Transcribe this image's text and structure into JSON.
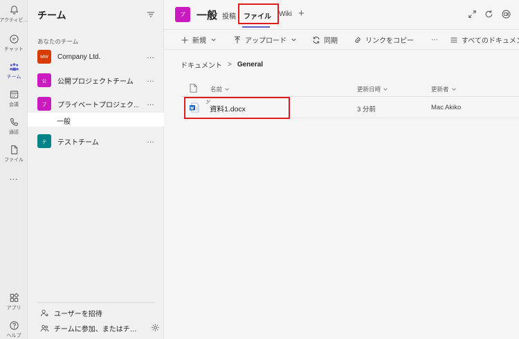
{
  "rail": {
    "items": [
      {
        "label": "アクティビ…",
        "icon": "bell-icon"
      },
      {
        "label": "チャット",
        "icon": "chat-icon"
      },
      {
        "label": "チーム",
        "icon": "teams-icon",
        "active": true
      },
      {
        "label": "会議",
        "icon": "calendar-icon"
      },
      {
        "label": "通話",
        "icon": "phone-icon"
      },
      {
        "label": "ファイル",
        "icon": "file-icon"
      }
    ],
    "more": "…",
    "apps_label": "アプリ",
    "help_label": "ヘルプ"
  },
  "sidebar": {
    "title": "チーム",
    "section_label": "あなたのチーム",
    "teams": [
      {
        "name": "Company Ltd.",
        "avatar": "MW",
        "color": "#d83b01"
      },
      {
        "name": "公開プロジェクトチーム",
        "avatar": "公",
        "color": "#c91bbf"
      },
      {
        "name": "プライベートプロジェク…",
        "avatar": "プ",
        "color": "#c91bbf"
      },
      {
        "name": "テストチーム",
        "avatar": "テ",
        "color": "#038387"
      }
    ],
    "more": "…",
    "channel": "一般",
    "invite_label": "ユーザーを招待",
    "join_label": "チームに参加、またはチ…"
  },
  "header": {
    "avatar": "プ",
    "title": "一般",
    "tabs": [
      "投稿",
      "ファイル",
      "Wiki"
    ],
    "active_tab": "ファイル",
    "add": "+"
  },
  "toolbar": {
    "new_label": "新規",
    "upload_label": "アップロード",
    "sync_label": "同期",
    "copy_link_label": "リンクをコピー",
    "more": "…",
    "all_docs_label": "すべてのドキュメント"
  },
  "breadcrumb": {
    "root": "ドキュメント",
    "separator": ">",
    "current": "General"
  },
  "files": {
    "columns": {
      "name": "名前",
      "modified": "更新日時",
      "modified_by": "更新者"
    },
    "rows": [
      {
        "name": "資料1.docx",
        "modified": "3 分前",
        "modified_by": "Mac Akiko"
      }
    ]
  },
  "colors": {
    "accent": "#5b5fc7",
    "highlight": "#e01b1b",
    "word": "#185abd"
  }
}
